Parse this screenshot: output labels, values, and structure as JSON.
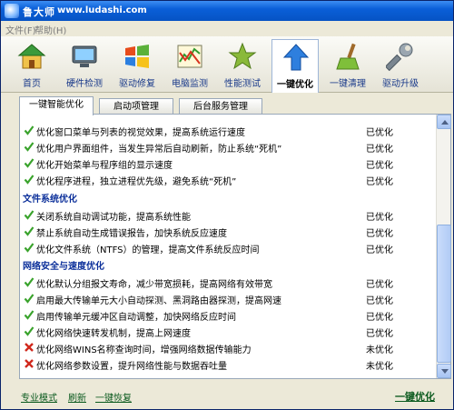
{
  "window": {
    "title": "鲁大师",
    "url": "www.ludashi.com"
  },
  "menu": {
    "file": "文件(F)",
    "help": "帮助(H)"
  },
  "toolbar": [
    {
      "label": "首页",
      "icon": "home-icon"
    },
    {
      "label": "硬件检测",
      "icon": "hardware-icon"
    },
    {
      "label": "驱动修复",
      "icon": "windows-icon"
    },
    {
      "label": "电脑监测",
      "icon": "monitor-chart-icon"
    },
    {
      "label": "性能测试",
      "icon": "star-icon"
    },
    {
      "label": "一键优化",
      "icon": "up-arrow-icon"
    },
    {
      "label": "一键清理",
      "icon": "broom-icon"
    },
    {
      "label": "驱动升级",
      "icon": "wrench-icon"
    }
  ],
  "tabs": [
    {
      "label": "一键智能优化"
    },
    {
      "label": "启动项管理"
    },
    {
      "label": "后台服务管理"
    }
  ],
  "sections": [
    {
      "title": "文件系统优化"
    },
    {
      "title": "网络安全与速度优化"
    }
  ],
  "rows": [
    {
      "text": "优化窗口菜单与列表的视觉效果，提高系统运行速度",
      "status": "已优化",
      "ok": true
    },
    {
      "text": "优化用户界面组件，当发生异常后自动刷新，防止系统“死机”",
      "status": "已优化",
      "ok": true
    },
    {
      "text": "优化开始菜单与程序组的显示速度",
      "status": "已优化",
      "ok": true
    },
    {
      "text": "优化程序进程，独立进程优先级，避免系统“死机”",
      "status": "已优化",
      "ok": true
    },
    {
      "text": "关闭系统自动调试功能，提高系统性能",
      "status": "已优化",
      "ok": true
    },
    {
      "text": "禁止系统自动生成错误报告，加快系统反应速度",
      "status": "已优化",
      "ok": true
    },
    {
      "text": "优化文件系统（NTFS）的管理，提高文件系统反应时间",
      "status": "已优化",
      "ok": true
    },
    {
      "text": "优化默认分组报文寿命，减少带宽损耗，提高网络有效带宽",
      "status": "已优化",
      "ok": true
    },
    {
      "text": "启用最大传输单元大小自动探测、黑洞路由器探测，提高网速",
      "status": "已优化",
      "ok": true
    },
    {
      "text": "启用传输单元缓冲区自动调整，加快网络反应时间",
      "status": "已优化",
      "ok": true
    },
    {
      "text": "优化网络快速转发机制，提高上网速度",
      "status": "已优化",
      "ok": true
    },
    {
      "text": "优化网络WINS名称查询时间，增强网络数据传输能力",
      "status": "未优化",
      "ok": false
    },
    {
      "text": "优化网络参数设置，提升网络性能与数据吞吐量",
      "status": "未优化",
      "ok": false
    }
  ],
  "footer": {
    "pro_mode": "专业模式",
    "refresh": "刷新",
    "restore": "一键恢复",
    "optimize": "一键优化"
  },
  "colors": {
    "accent": "#0a5fd8",
    "ok": "#3aa32c",
    "fail": "#d0281c",
    "section": "#0b2f9a"
  }
}
